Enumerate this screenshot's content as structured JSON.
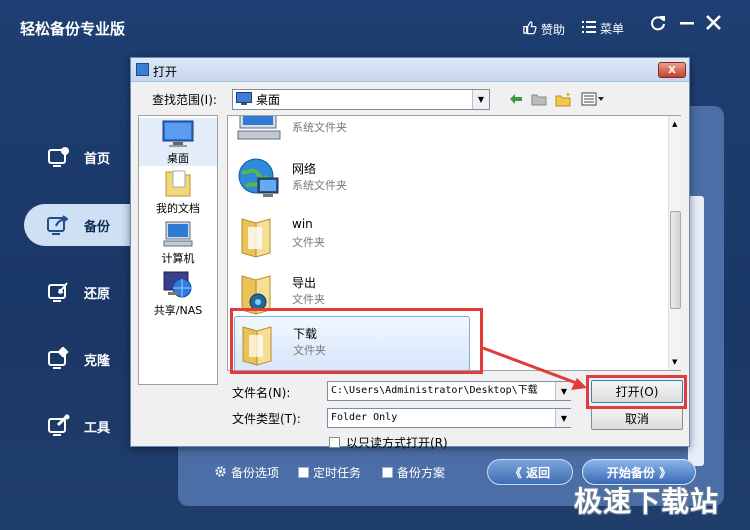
{
  "app": {
    "title": "轻松备份专业版",
    "sponsor_label": "赞助",
    "menu_label": "菜单"
  },
  "nav": [
    {
      "label": "首页",
      "icon": "home-icon"
    },
    {
      "label": "备份",
      "icon": "backup-icon",
      "active": true
    },
    {
      "label": "还原",
      "icon": "restore-icon"
    },
    {
      "label": "克隆",
      "icon": "clone-icon"
    },
    {
      "label": "工具",
      "icon": "tools-icon"
    }
  ],
  "bottom": {
    "backup_options": "备份选项",
    "scheduled_task": "定时任务",
    "backup_scheme": "备份方案",
    "back_button": "《 返回",
    "start_button": "开始备份 》"
  },
  "watermark": "极速下载站",
  "dialog": {
    "title": "打开",
    "close": "X",
    "look_in_label": "查找范围(I):",
    "look_in_value": "桌面",
    "places": [
      {
        "label": "桌面",
        "icon": "desktop-icon"
      },
      {
        "label": "我的文档",
        "icon": "documents-icon"
      },
      {
        "label": "计算机",
        "icon": "computer-icon"
      },
      {
        "label": "共享/NAS",
        "icon": "network-share-icon"
      }
    ],
    "files": [
      {
        "name": "",
        "type": "系统文件夹",
        "icon": "computer-icon"
      },
      {
        "name": "网络",
        "type": "系统文件夹",
        "icon": "network-globe-icon"
      },
      {
        "name": "win",
        "type": "文件夹",
        "icon": "folder-icon"
      },
      {
        "name": "导出",
        "type": "文件夹",
        "icon": "folder-icon"
      },
      {
        "name": "下载",
        "type": "文件夹",
        "icon": "folder-icon",
        "selected": true
      }
    ],
    "filename_label": "文件名(N):",
    "filename_value": "C:\\Users\\Administrator\\Desktop\\下载",
    "filetype_label": "文件类型(T):",
    "filetype_value": "Folder Only",
    "readonly_label": "以只读方式打开(R)",
    "open_button": "打开(O)",
    "cancel_button": "取消"
  },
  "colors": {
    "app_bg": "#1e3f73",
    "highlight_red": "#e23b3b",
    "selection": "#d6e6fb"
  }
}
